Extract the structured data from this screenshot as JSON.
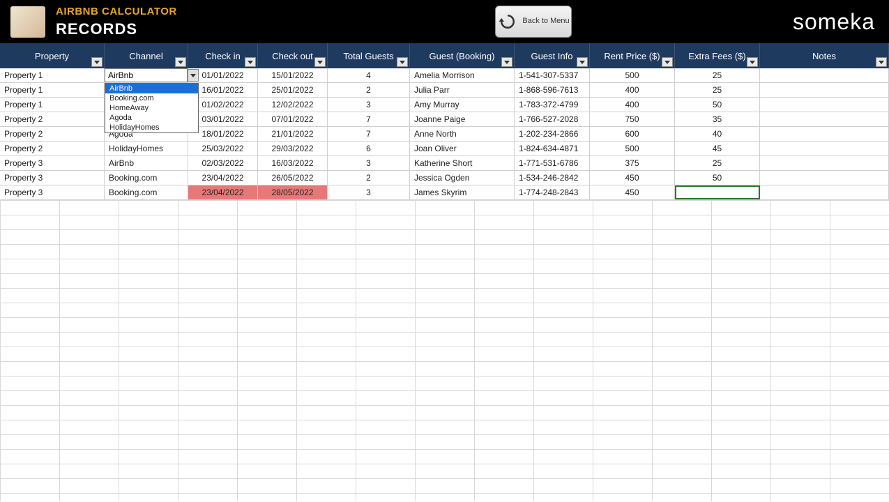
{
  "header": {
    "app_title": "AIRBNB CALCULATOR",
    "page_title": "RECORDS",
    "back_label": "Back to Menu",
    "brand": "someka"
  },
  "columns": [
    {
      "label": "Property",
      "class": "col-property"
    },
    {
      "label": "Channel",
      "class": "col-channel"
    },
    {
      "label": "Check in",
      "class": "col-checkin"
    },
    {
      "label": "Check out",
      "class": "col-checkout"
    },
    {
      "label": "Total Guests",
      "class": "col-guests"
    },
    {
      "label": "Guest (Booking)",
      "class": "col-booking"
    },
    {
      "label": "Guest Info",
      "class": "col-info"
    },
    {
      "label": "Rent Price ($)",
      "class": "col-rent"
    },
    {
      "label": "Extra Fees ($)",
      "class": "col-extra"
    },
    {
      "label": "Notes",
      "class": "col-notes"
    }
  ],
  "dropdown": {
    "editing_value": "AirBnb",
    "options": [
      "AirBnb",
      "Booking.com",
      "HomeAway",
      "Agoda",
      "HolidayHomes"
    ],
    "selected_index": 0
  },
  "rows": [
    {
      "property": "Property 1",
      "channel": "AirBnb",
      "checkin": "01/01/2022",
      "checkout": "15/01/2022",
      "guests": "4",
      "guest": "Amelia Morrison",
      "info": "1-541-307-5337",
      "rent": "500",
      "extra": "25",
      "editing": true
    },
    {
      "property": "Property 1",
      "channel": "",
      "checkin": "16/01/2022",
      "checkout": "25/01/2022",
      "guests": "2",
      "guest": "Julia Parr",
      "info": "1-868-596-7613",
      "rent": "400",
      "extra": "25"
    },
    {
      "property": "Property 1",
      "channel": "",
      "checkin": "01/02/2022",
      "checkout": "12/02/2022",
      "guests": "3",
      "guest": "Amy Murray",
      "info": "1-783-372-4799",
      "rent": "400",
      "extra": "50"
    },
    {
      "property": "Property 2",
      "channel": "",
      "checkin": "03/01/2022",
      "checkout": "07/01/2022",
      "guests": "7",
      "guest": "Joanne Paige",
      "info": "1-766-527-2028",
      "rent": "750",
      "extra": "35"
    },
    {
      "property": "Property 2",
      "channel": "Agoda",
      "checkin": "18/01/2022",
      "checkout": "21/01/2022",
      "guests": "7",
      "guest": "Anne North",
      "info": "1-202-234-2866",
      "rent": "600",
      "extra": "40"
    },
    {
      "property": "Property 2",
      "channel": "HolidayHomes",
      "checkin": "25/03/2022",
      "checkout": "29/03/2022",
      "guests": "6",
      "guest": "Joan Oliver",
      "info": "1-824-634-4871",
      "rent": "500",
      "extra": "45"
    },
    {
      "property": "Property 3",
      "channel": "AirBnb",
      "checkin": "02/03/2022",
      "checkout": "16/03/2022",
      "guests": "3",
      "guest": "Katherine Short",
      "info": "1-771-531-6786",
      "rent": "375",
      "extra": "25"
    },
    {
      "property": "Property 3",
      "channel": "Booking.com",
      "checkin": "23/04/2022",
      "checkout": "26/05/2022",
      "guests": "2",
      "guest": "Jessica Ogden",
      "info": "1-534-246-2842",
      "rent": "450",
      "extra": "50"
    },
    {
      "property": "Property 3",
      "channel": "Booking.com",
      "checkin": "23/04/2022",
      "checkout": "28/05/2022",
      "guests": "3",
      "guest": "James Skyrim",
      "info": "1-774-248-2843",
      "rent": "450",
      "extra": "",
      "highlight_dates": true,
      "extra_selected": true
    }
  ]
}
